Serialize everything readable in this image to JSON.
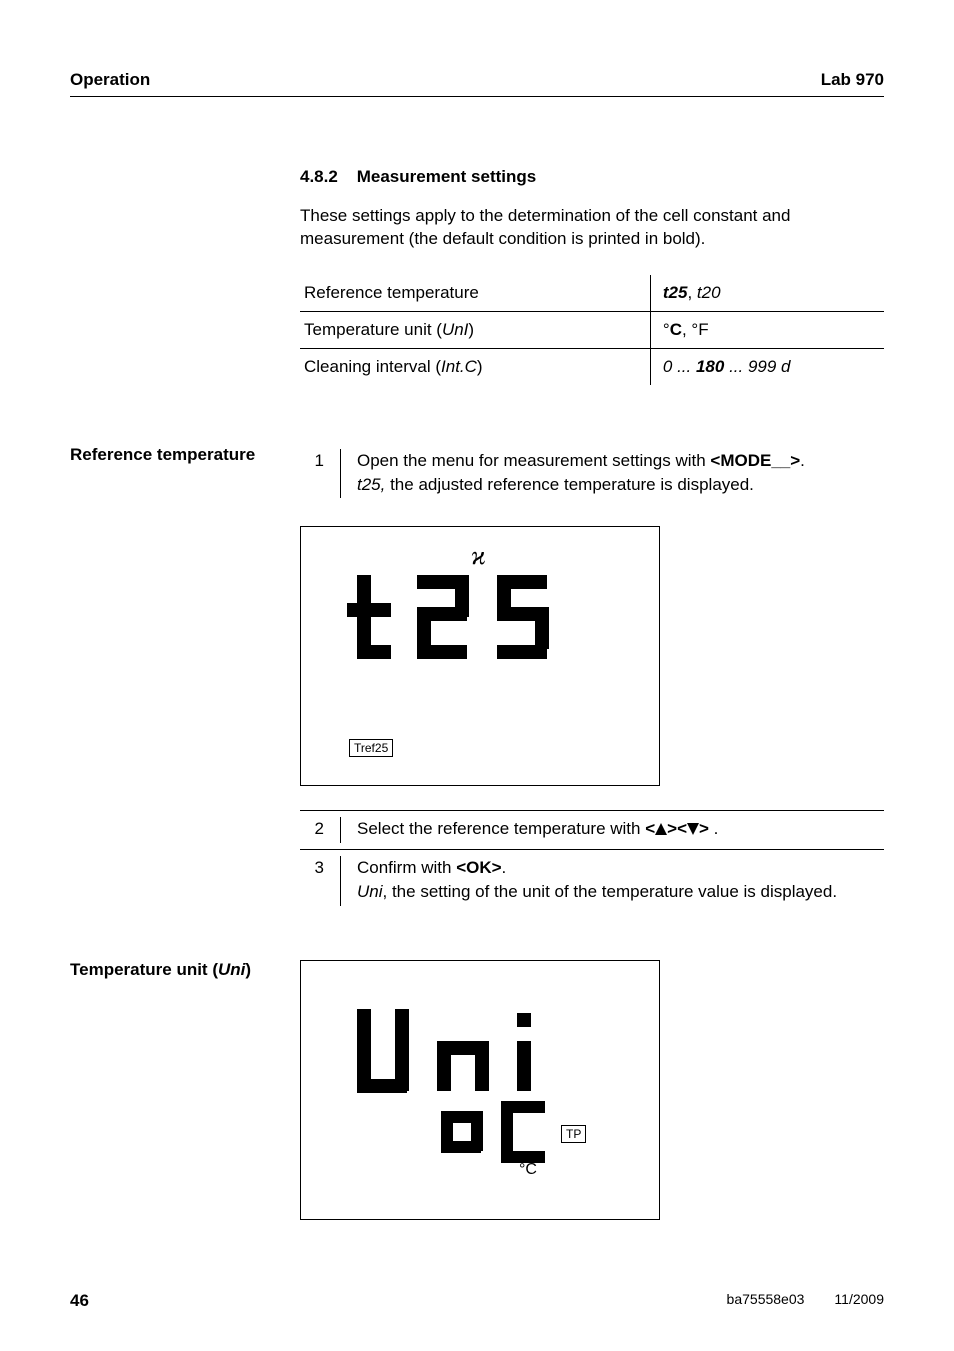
{
  "header": {
    "left": "Operation",
    "right": "Lab 970"
  },
  "section": {
    "number": "4.8.2",
    "title": "Measurement settings",
    "intro": "These settings apply to the determination of the cell constant and measurement (the default condition is printed in bold)."
  },
  "settings_table": [
    {
      "key_plain": "Reference temperature",
      "key_italic": "",
      "val_parts": [
        {
          "text": "t25",
          "style": "bolditalic"
        },
        {
          "text": ", ",
          "style": ""
        },
        {
          "text": "t20",
          "style": "italic"
        }
      ]
    },
    {
      "key_plain": "Temperature unit (",
      "key_italic": "UnI",
      "key_close": ")",
      "val_parts": [
        {
          "text": "°",
          "style": ""
        },
        {
          "text": "C",
          "style": "bold"
        },
        {
          "text": ", °F",
          "style": ""
        }
      ]
    },
    {
      "key_plain": "Cleaning interval (",
      "key_italic": "Int.C",
      "key_close": ")",
      "val_parts": [
        {
          "text": "0 ... ",
          "style": "italic"
        },
        {
          "text": "180",
          "style": "bolditalic"
        },
        {
          "text": " ... 999 d",
          "style": "italic"
        }
      ]
    }
  ],
  "ref_temp": {
    "label": "Reference temperature",
    "step1_prefix": "Open the menu for measurement settings with ",
    "step1_button": "<MODE__>",
    "step1_suffix": ".",
    "step1_line2_italic": "t25,",
    "step1_line2_rest": " the adjusted reference temperature is displayed.",
    "step2_prefix": "Select the reference temperature with ",
    "step2_suffix": " .",
    "step3_prefix": "Confirm with ",
    "step3_button": "<OK>",
    "step3_suffix": ".",
    "step3_line2_italic": "Uni",
    "step3_line2_rest": ", the setting of the unit of the temperature value is displayed."
  },
  "lcd1": {
    "chi": "ϰ",
    "main": "t25",
    "tag": "Tref25"
  },
  "temp_unit": {
    "label_prefix": "Temperature unit  (",
    "label_italic": "Uni",
    "label_suffix": ")"
  },
  "lcd2": {
    "main": "Uni",
    "sub": "oC",
    "degc": "°C",
    "tp": "TP"
  },
  "steps_nums": {
    "s1": "1",
    "s2": "2",
    "s3": "3"
  },
  "angle": {
    "open": "<",
    "close": ">"
  },
  "footer": {
    "page": "46",
    "doc": "ba75558e03",
    "date": "11/2009"
  }
}
